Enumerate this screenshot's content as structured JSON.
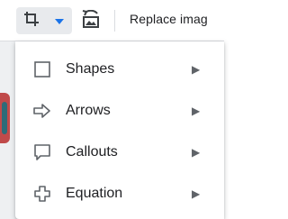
{
  "toolbar": {
    "crop_icon": "crop-icon",
    "dropdown_icon": "caret-down-icon",
    "reset_icon": "reset-image-icon",
    "replace_label": "Replace imag"
  },
  "menu": {
    "items": [
      {
        "label": "Shapes",
        "icon": "square-outline-icon"
      },
      {
        "label": "Arrows",
        "icon": "arrow-right-outline-icon"
      },
      {
        "label": "Callouts",
        "icon": "callout-bubble-icon"
      },
      {
        "label": "Equation",
        "icon": "cross-outline-icon"
      }
    ]
  },
  "colors": {
    "accent": "#1a73e8",
    "icon": "#5f6368",
    "text": "#202124"
  }
}
